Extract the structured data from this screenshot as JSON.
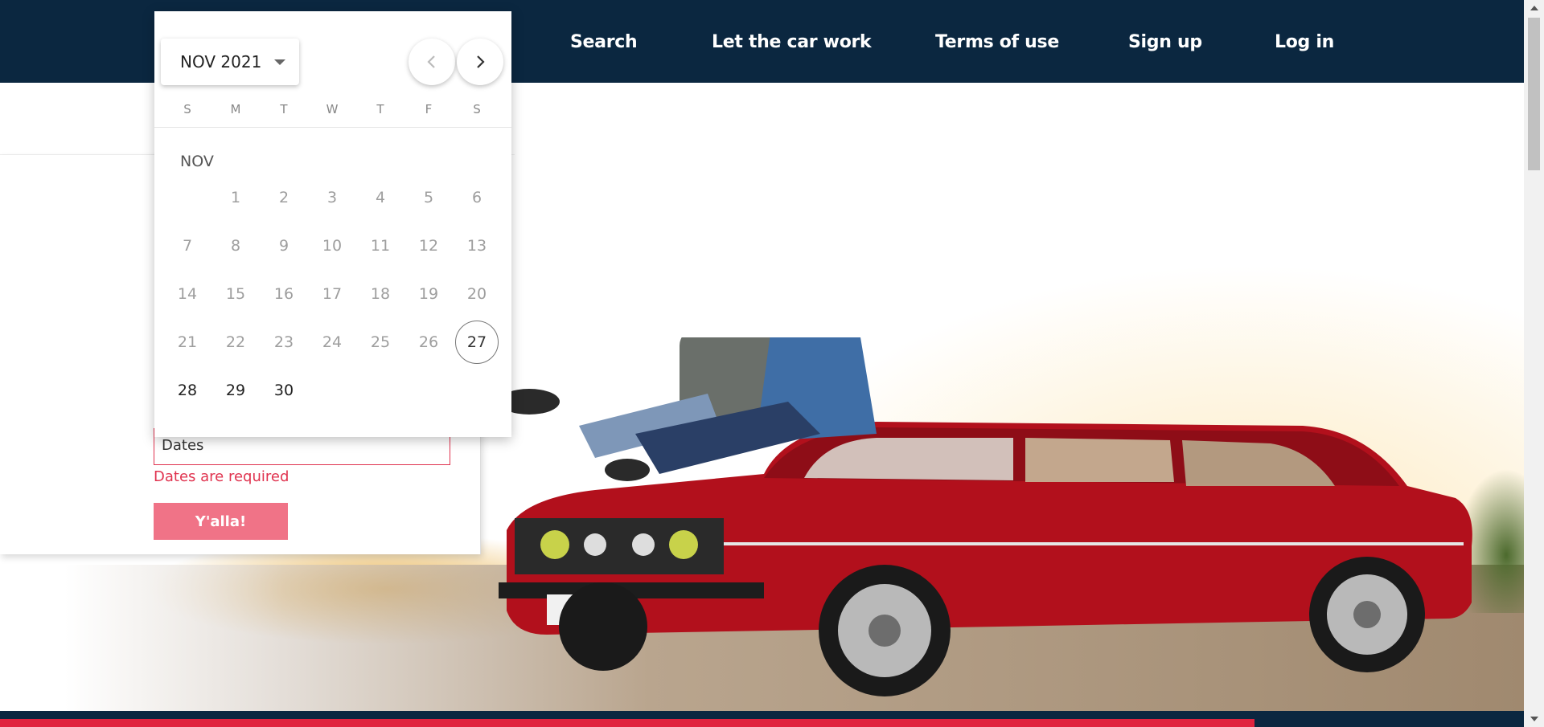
{
  "header": {
    "nav": [
      {
        "label": "Search"
      },
      {
        "label": "Let the car work"
      },
      {
        "label": "Terms of use"
      },
      {
        "label": "Sign up"
      },
      {
        "label": "Log in"
      }
    ]
  },
  "form": {
    "dates_placeholder": "Dates",
    "dates_error": "Dates are required",
    "submit_label": "Y'alla!"
  },
  "datepicker": {
    "month_year": "NOV 2021",
    "month_label": "NOV",
    "weekdays": [
      "S",
      "M",
      "T",
      "W",
      "T",
      "F",
      "S"
    ],
    "weeks": [
      [
        "",
        "1",
        "2",
        "3",
        "4",
        "5",
        "6"
      ],
      [
        "7",
        "8",
        "9",
        "10",
        "11",
        "12",
        "13"
      ],
      [
        "14",
        "15",
        "16",
        "17",
        "18",
        "19",
        "20"
      ],
      [
        "21",
        "22",
        "23",
        "24",
        "25",
        "26",
        "27"
      ],
      [
        "28",
        "29",
        "30",
        "",
        "",
        "",
        ""
      ]
    ],
    "today": "27",
    "selectable_days": [
      "27",
      "28",
      "29",
      "30"
    ]
  },
  "colors": {
    "header_bg": "#0b2740",
    "accent_red": "#e0334f",
    "button_pink": "#f07387"
  },
  "icons": {
    "prev": "chevron-left-icon",
    "next": "chevron-right-icon",
    "month_caret": "caret-down-icon"
  }
}
